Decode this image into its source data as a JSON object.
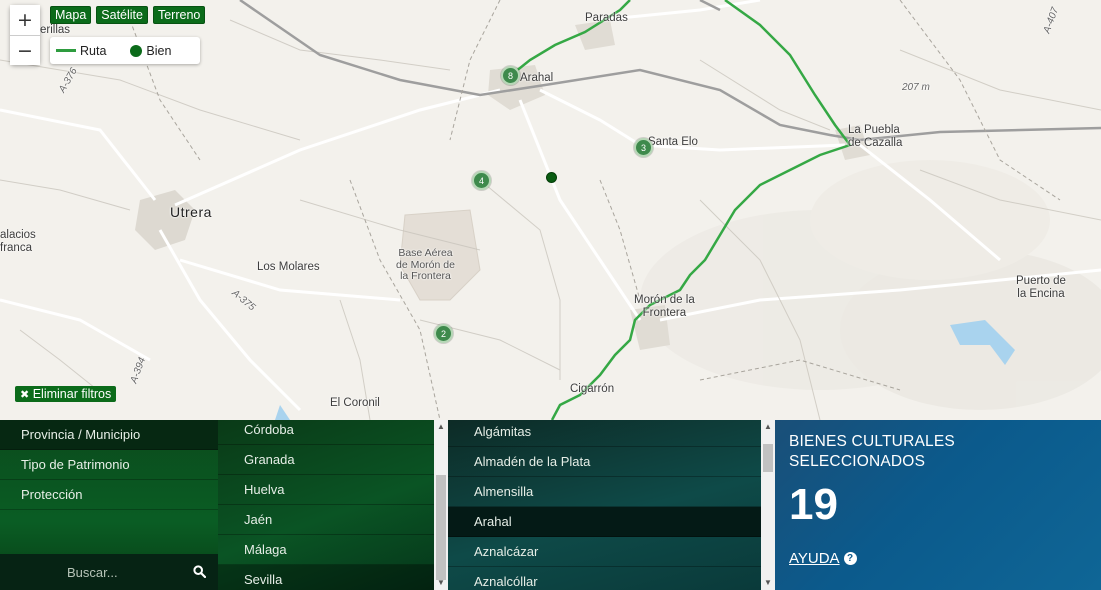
{
  "map": {
    "zoom_in": "+",
    "zoom_out": "−",
    "layers": [
      "Mapa",
      "Satélite",
      "Terreno"
    ],
    "legend": {
      "route": "Ruta",
      "site": "Bien"
    },
    "clear_filters": "Eliminar filtros",
    "places": {
      "paradas": "Paradas",
      "arahal": "Arahal",
      "santa_elo": "Santa Elo",
      "la_puebla": "La Puebla\nde Cazalla",
      "utrera": "Utrera",
      "los_molares": "Los Molares",
      "base": "Base Aérea\nde Morón de\nla Frontera",
      "moron": "Morón de la\nFrontera",
      "puerto": "Puerto de\nla Encina",
      "el_coronil": "El Coronil",
      "cigarron": "Cigarrón",
      "palacios": "alacios\nfranca",
      "cerrillas": "erillas",
      "a376": "A-376",
      "a375": "A-375",
      "a394": "A-394",
      "a407": "A-407",
      "alt": "207 m"
    },
    "markers": [
      "8",
      "3",
      "4",
      "2"
    ],
    "route_color": "#2e9c3f",
    "marker_color": "#3e8a4c"
  },
  "filters": {
    "categories": [
      "Provincia / Municipio",
      "Tipo de Patrimonio",
      "Protección"
    ],
    "search_placeholder": "Buscar...",
    "provinces": [
      "Córdoba",
      "Granada",
      "Huelva",
      "Jaén",
      "Málaga",
      "Sevilla"
    ],
    "municipalities": [
      "Algámitas",
      "Almadén de la Plata",
      "Almensilla",
      "Arahal",
      "Aznalcázar",
      "Aznalcóllar"
    ]
  },
  "summary": {
    "title": "BIENES CULTURALES SELECCIONADOS",
    "count": "19",
    "help": "AYUDA",
    "help_icon": "?"
  }
}
